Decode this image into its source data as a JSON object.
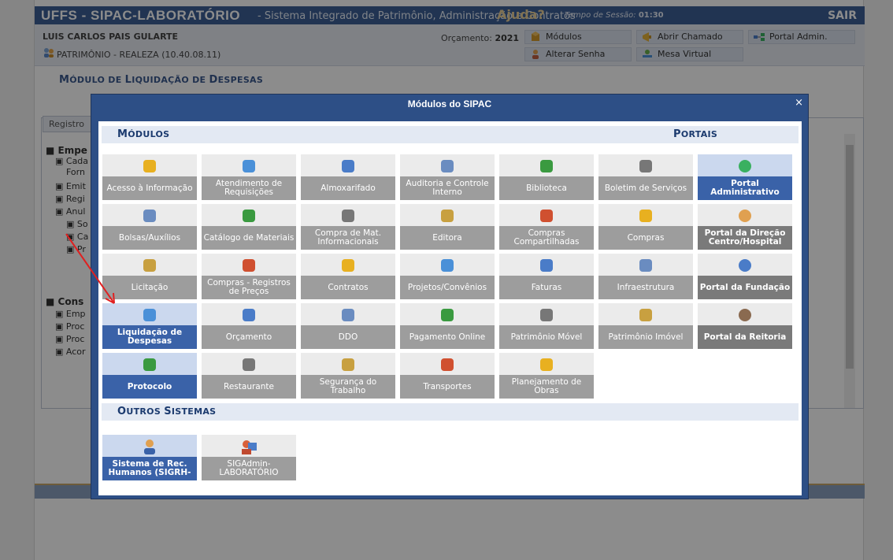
{
  "header": {
    "brand": "UFFS - SIPAC-LABORATÓRIO",
    "subtitle": "- Sistema Integrado de Patrimônio, Administração e Contratos",
    "help": "Ajuda?",
    "session_label": "Tempo de Sessão:",
    "session_time": "01:30",
    "logout": "SAIR"
  },
  "user": {
    "name": "LUIS CARLOS PAIS GULARTE",
    "unit": "PATRIMÔNIO - REALEZA (10.40.08.11)",
    "budget_label": "Orçamento:",
    "budget_year": "2021"
  },
  "quick_links": [
    "Módulos",
    "Abrir Chamado",
    "Portal Admin.",
    "Alterar Senha",
    "Mesa Virtual"
  ],
  "module_title": {
    "first": "M",
    "rest": "ÓDULO DE",
    "first2": "L",
    "rest2": "IQUIDAÇÃO DE",
    "first3": "D",
    "rest3": "ESPESAS"
  },
  "background": {
    "tab": "Registro",
    "items": [
      "Empe",
      "Cada",
      "Forn",
      "Emit",
      "Regi",
      "Anul",
      "So",
      "Ca",
      "Pr",
      "Cons",
      "Emp",
      "Proc",
      "Proc",
      "Acor"
    ]
  },
  "dialog": {
    "title": "Módulos do SIPAC",
    "close": "×",
    "sections": {
      "modules": "MÓDULOS",
      "portals": "PORTAIS",
      "others": "OUTROS SISTEMAS"
    },
    "rows": [
      [
        "Acesso à Informação",
        "Atendimento de Requisições",
        "Almoxarifado",
        "Auditoria e Controle Interno",
        "Biblioteca",
        "Boletim de Serviços"
      ],
      [
        "Bolsas/Auxílios",
        "Catálogo de Materiais",
        "Compra de Mat. Informacionais",
        "Editora",
        "Compras Compartilhadas",
        "Compras"
      ],
      [
        "Licitação",
        "Compras - Registros de Preços",
        "Contratos",
        "Projetos/Convênios",
        "Faturas",
        "Infraestrutura"
      ],
      [
        "Liquidação de Despesas",
        "Orçamento",
        "DDO",
        "Pagamento Online",
        "Patrimônio Móvel",
        "Patrimônio Imóvel"
      ],
      [
        "Protocolo",
        "Restaurante",
        "Segurança do Trabalho",
        "Transportes",
        "Planejamento de Obras"
      ]
    ],
    "portals": [
      "Portal Administrativo",
      "Portal da Direção Centro/Hospital",
      "Portal da Fundação",
      "Portal da Reitoria"
    ],
    "other_systems": [
      "Sistema de Rec. Humanos (SIGRH-",
      "SIGAdmin-LABORATÓRIO"
    ]
  },
  "colors": {
    "header_bg": "#3c5f96",
    "dialog_bg": "#2d4f86",
    "enabled_tile": "#3a62a8",
    "disabled_tile": "#9c9c9c",
    "arrow": "#e02020"
  }
}
